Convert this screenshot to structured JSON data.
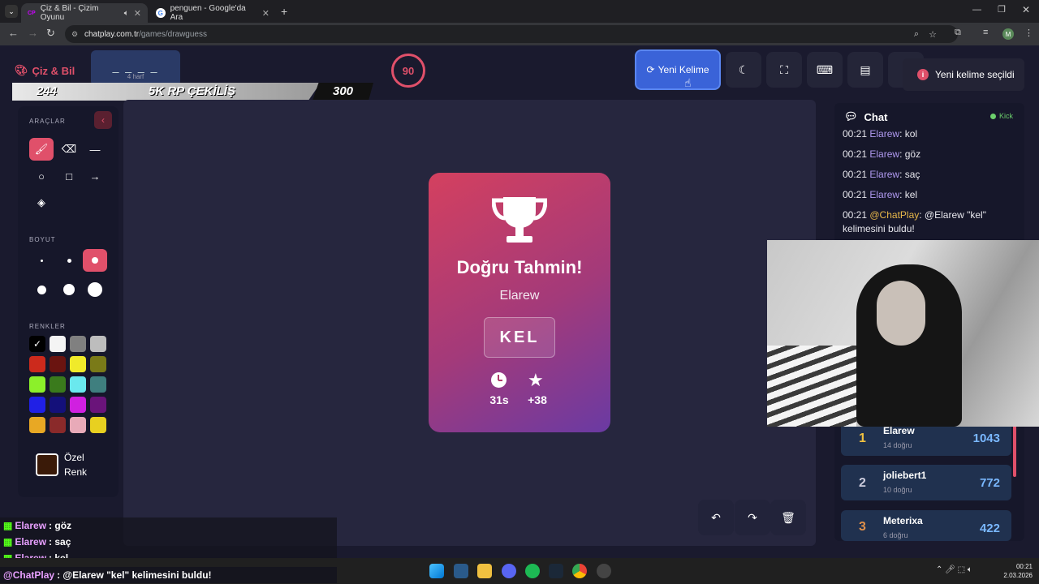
{
  "browser": {
    "tabs": [
      {
        "label": "Çiz & Bil - Çizim Oyunu",
        "favicon": "CP"
      },
      {
        "label": "penguen - Google'da Ara",
        "favicon": "G"
      }
    ],
    "url_host": "chatplay.com.tr",
    "url_path": "/games/drawguess",
    "profile_initial": "M"
  },
  "header": {
    "logo": "Çiz & Bil",
    "word_mask": "_ _ _ _",
    "word_hint": "4 harf",
    "timer": "90",
    "new_word_label": "Yeni Kelime",
    "toast": "Yeni kelime seçildi"
  },
  "banner": {
    "left": "244",
    "center": "5K RP ÇEKİLİŞ",
    "right": "300"
  },
  "tools": {
    "title_tools": "ARAÇLAR",
    "title_size": "BOYUT",
    "title_colors": "RENKLER",
    "custom_color_line1": "Özel",
    "custom_color_line2": "Renk",
    "colors": [
      "#000000",
      "#f4f4f4",
      "#808080",
      "#bdbdbd",
      "#cc2a1c",
      "#6a1410",
      "#f0ea2a",
      "#7a7a18",
      "#8cf02a",
      "#3a7a1c",
      "#6ae8ee",
      "#3f7f7f",
      "#2020e6",
      "#14107a",
      "#d020e0",
      "#6a147a",
      "#e8a824",
      "#8a2a2a",
      "#e8aab8",
      "#e8d020"
    ],
    "custom_color": "#3a1a08"
  },
  "result": {
    "title": "Doğru Tahmin!",
    "player": "Elarew",
    "word": "KEL",
    "time": "31s",
    "points": "+38"
  },
  "chat": {
    "title": "Chat",
    "source": "Kick",
    "messages": [
      {
        "time": "00:21",
        "user": "Elarew",
        "text": ": kol"
      },
      {
        "time": "00:21",
        "user": "Elarew",
        "text": ": göz"
      },
      {
        "time": "00:21",
        "user": "Elarew",
        "text": ": saç"
      },
      {
        "time": "00:21",
        "user": "Elarew",
        "text": ": kel"
      },
      {
        "time": "00:21",
        "user": "@ChatPlay",
        "text": ": @Elarew \"kel\" kelimesini buldu!"
      }
    ]
  },
  "leaderboard": [
    {
      "rank": "1",
      "name": "Elarew",
      "sub": "14 doğru",
      "score": "1043"
    },
    {
      "rank": "2",
      "name": "joliebert1",
      "sub": "10 doğru",
      "score": "772"
    },
    {
      "rank": "3",
      "name": "Meterixa",
      "sub": "6 doğru",
      "score": "422"
    }
  ],
  "overlay_chat": [
    {
      "user": "Elarew",
      "text": ": göz"
    },
    {
      "user": "Elarew",
      "text": ": saç"
    },
    {
      "user": "Elarew",
      "text": ": kel"
    },
    {
      "user": "@ChatPlay",
      "text": ": @Elarew \"kel\" kelimesini buldu!"
    }
  ],
  "taskbar": {
    "time": "00:21",
    "date": "2.03.2026"
  },
  "colors": {
    "accent_blue": "#3a63d8",
    "accent_red": "#e0506a",
    "score_blue": "#7ab8ff",
    "rank_gold": "#f0c040"
  }
}
